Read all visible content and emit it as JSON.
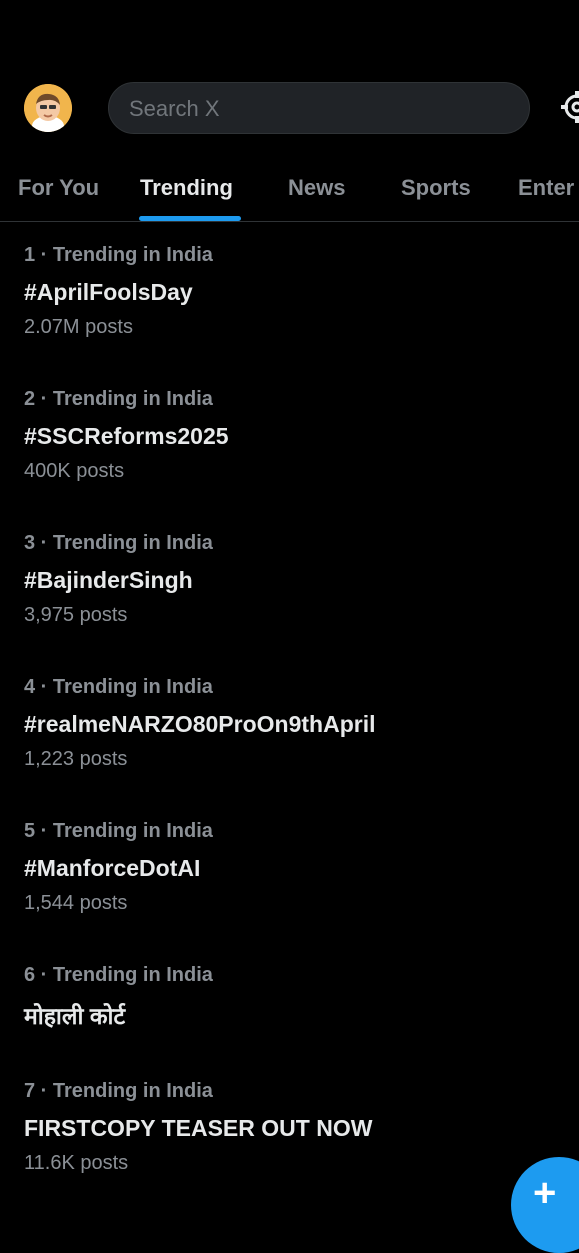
{
  "search": {
    "placeholder": "Search X"
  },
  "icons": {
    "avatar": "avatar-image",
    "settings": "gear-icon",
    "compose": "plus-icon"
  },
  "tabs": [
    {
      "label": "For You"
    },
    {
      "label": "Trending",
      "active": true
    },
    {
      "label": "News"
    },
    {
      "label": "Sports"
    },
    {
      "label": "Enter"
    }
  ],
  "trends": [
    {
      "meta": "1 · Trending in India",
      "name": "#AprilFoolsDay",
      "count": "2.07M posts"
    },
    {
      "meta": "2 · Trending in India",
      "name": "#SSCReforms2025",
      "count": "400K posts"
    },
    {
      "meta": "3 · Trending in India",
      "name": "#BajinderSingh",
      "count": "3,975 posts"
    },
    {
      "meta": "4 · Trending in India",
      "name": "#realmeNARZO80ProOn9thApril",
      "count": "1,223 posts"
    },
    {
      "meta": "5 · Trending in India",
      "name": "#ManforceDotAI",
      "count": "1,544 posts"
    },
    {
      "meta": "6 · Trending in India",
      "name": "मोहाली कोर्ट",
      "count": ""
    },
    {
      "meta": "7 · Trending in India",
      "name": "FIRSTCOPY TEASER OUT NOW",
      "count": "11.6K posts"
    }
  ],
  "fab": {
    "label": "+"
  },
  "colors": {
    "accent": "#1d9bf0",
    "background": "#000000",
    "muted": "#8b9096"
  }
}
